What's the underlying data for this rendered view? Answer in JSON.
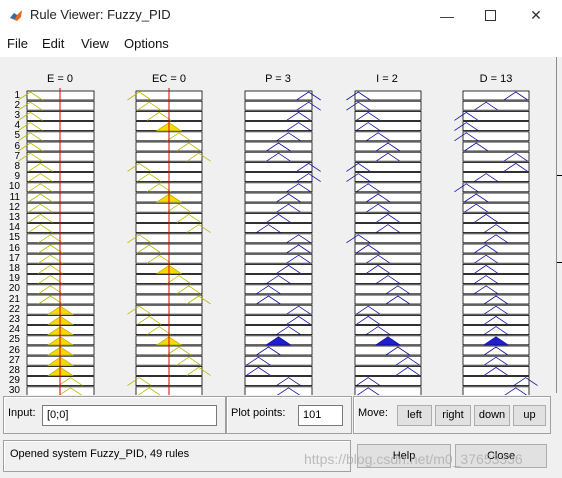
{
  "window": {
    "title": "Rule Viewer: Fuzzy_PID",
    "minimize_icon": "minimize-icon",
    "maximize_icon": "maximize-icon",
    "close_icon": "close-icon"
  },
  "menu": [
    "File",
    "Edit",
    "View",
    "Options"
  ],
  "columns": [
    {
      "label": "E = 0",
      "type": "input"
    },
    {
      "label": "EC = 0",
      "type": "input"
    },
    {
      "label": "P = 3",
      "type": "output"
    },
    {
      "label": "I = 2",
      "type": "output"
    },
    {
      "label": "D = 13",
      "type": "output"
    }
  ],
  "rule_numbers": [
    "1",
    "2",
    "3",
    "4",
    "5",
    "6",
    "7",
    "8",
    "9",
    "10",
    "11",
    "12",
    "13",
    "14",
    "15",
    "16",
    "17",
    "18",
    "19",
    "20",
    "21",
    "22",
    "23",
    "24",
    "25",
    "26",
    "27",
    "28",
    "29",
    "30"
  ],
  "input_panel": {
    "label": "Input:",
    "value": "[0;0]"
  },
  "plot_points": {
    "label": "Plot points:",
    "value": "101"
  },
  "move": {
    "label": "Move:",
    "buttons": [
      "left",
      "right",
      "down",
      "up"
    ]
  },
  "status": "Opened system Fuzzy_PID, 49 rules",
  "buttons": {
    "help": "Help",
    "close": "Close"
  },
  "watermark": "https://blog.csdn.net/m0_37653336",
  "colors": {
    "input_fill": "#ffd700",
    "output_fill": "#1f1fd0",
    "indicator": "#e00000",
    "input_line": "#b8b800",
    "output_line": "#1010a0"
  }
}
